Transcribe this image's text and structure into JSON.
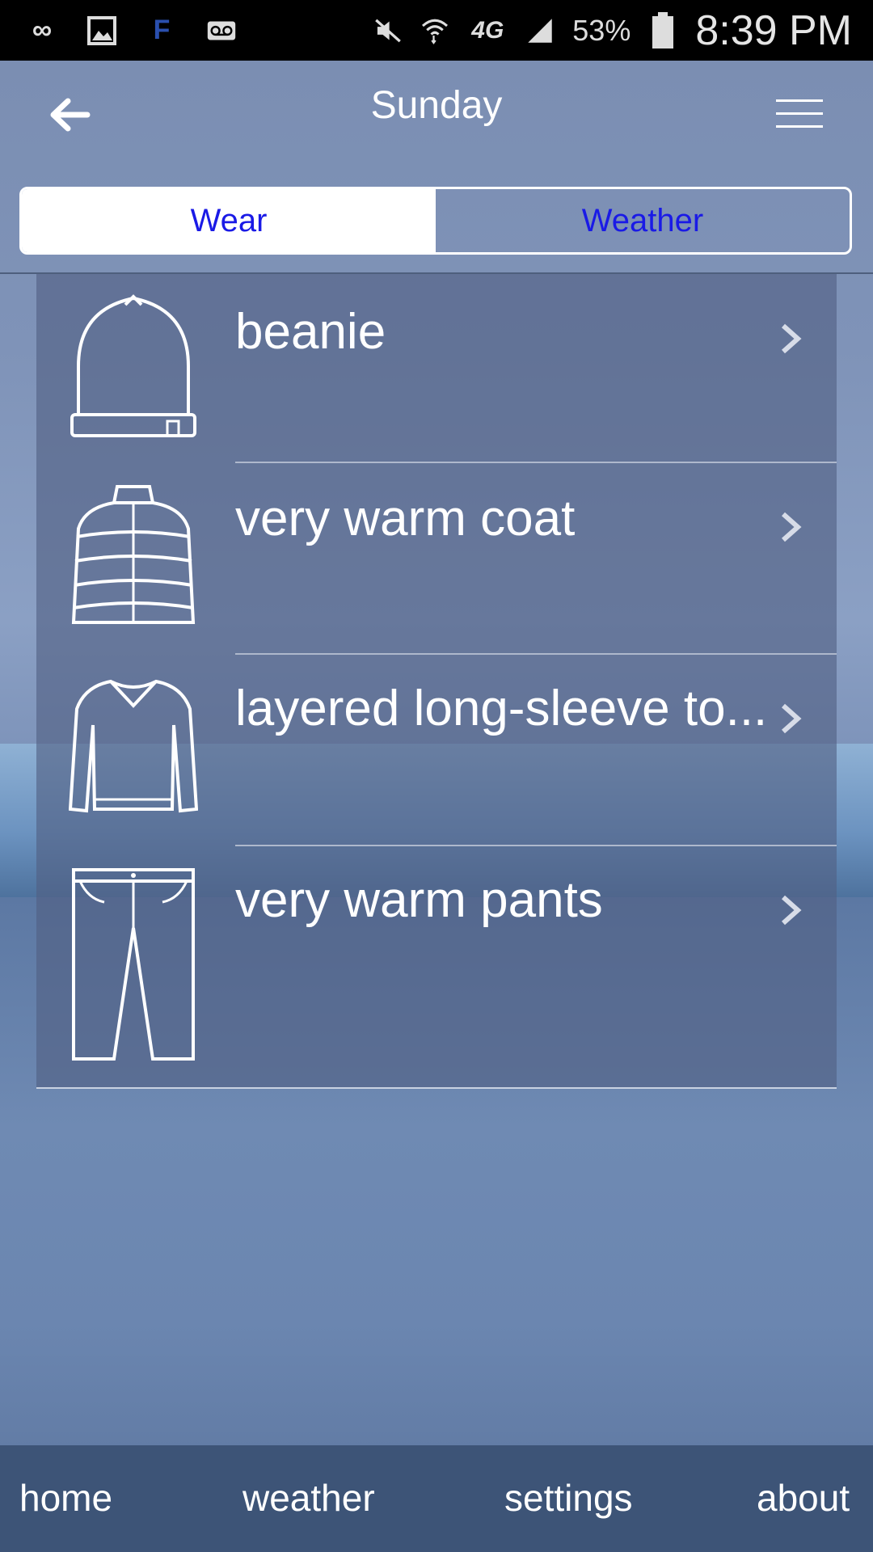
{
  "status_bar": {
    "battery": "53%",
    "time": "8:39 PM",
    "network": "4G LTE",
    "icons": [
      "infinity-icon",
      "gallery-icon",
      "f-app-icon",
      "voicemail-icon",
      "mute-icon",
      "wifi-icon",
      "network-4g-icon",
      "signal-icon",
      "battery-icon"
    ]
  },
  "header": {
    "title": "Sunday"
  },
  "tabs": [
    {
      "label": "Wear",
      "active": true
    },
    {
      "label": "Weather",
      "active": false
    }
  ],
  "items": [
    {
      "label": "beanie",
      "icon": "beanie-icon"
    },
    {
      "label": "very warm coat",
      "icon": "coat-icon"
    },
    {
      "label": "layered long-sleeve to...",
      "icon": "sweater-icon"
    },
    {
      "label": "very warm pants",
      "icon": "pants-icon"
    }
  ],
  "bottom_nav": [
    {
      "label": "home"
    },
    {
      "label": "weather"
    },
    {
      "label": "settings"
    },
    {
      "label": "about"
    }
  ],
  "colors": {
    "tab_text": "#1a1ae6",
    "nav_bg": "#3d5477",
    "panel_bg": "rgba(80,96,130,0.62)"
  }
}
